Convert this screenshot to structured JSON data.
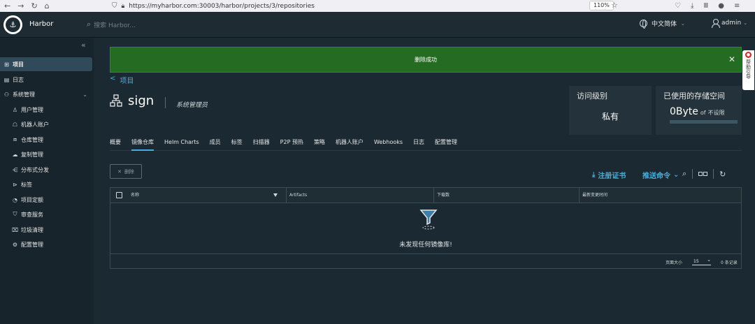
{
  "browser": {
    "nav_back": "←",
    "nav_forward": "→",
    "nav_reload": "↻",
    "nav_home": "⌂",
    "url": "https://myharbor.com:30003/harbor/projects/3/repositories",
    "zoom": "110%",
    "star": "☆"
  },
  "header": {
    "brand": "Harbor",
    "search_placeholder": "搜索 Harbor...",
    "language": "中文简体",
    "user": "admin"
  },
  "sidebar": {
    "items": [
      {
        "label": "项目",
        "icon": "projects-icon",
        "glyph": "⊞"
      },
      {
        "label": "日志",
        "icon": "logs-icon",
        "glyph": "▤"
      },
      {
        "label": "系统管理",
        "icon": "admin-icon",
        "glyph": "⚇"
      },
      {
        "label": "用户管理",
        "icon": "users-icon",
        "glyph": "♙"
      },
      {
        "label": "机器人账户",
        "icon": "robot-icon",
        "glyph": "☖"
      },
      {
        "label": "仓库管理",
        "icon": "registry-icon",
        "glyph": "⧈"
      },
      {
        "label": "复制管理",
        "icon": "replication-icon",
        "glyph": "☁"
      },
      {
        "label": "分布式分发",
        "icon": "distribution-icon",
        "glyph": "⋲"
      },
      {
        "label": "标签",
        "icon": "tag-icon",
        "glyph": "⊳"
      },
      {
        "label": "项目定额",
        "icon": "quota-icon",
        "glyph": "◔"
      },
      {
        "label": "审查服务",
        "icon": "shield-icon",
        "glyph": "⛉"
      },
      {
        "label": "垃圾清理",
        "icon": "trash-icon",
        "glyph": "⌧"
      },
      {
        "label": "配置管理",
        "icon": "settings-icon",
        "glyph": "⚙"
      }
    ]
  },
  "toast": {
    "message": "删除成功"
  },
  "side_tab": {
    "text": "帮助引导"
  },
  "project": {
    "back_label": "项目",
    "name": "sign",
    "role": "系统管理员"
  },
  "cards": {
    "access_title": "访问级别",
    "access_value": "私有",
    "storage_title": "已使用的存储空间",
    "storage_value": "0Byte",
    "storage_of": "of",
    "storage_limit": "不设限",
    "storage_used_fraction": 0
  },
  "tabs": [
    "概要",
    "镜像仓库",
    "Helm Charts",
    "成员",
    "标签",
    "扫描器",
    "P2P 预热",
    "策略",
    "机器人账户",
    "Webhooks",
    "日志",
    "配置管理"
  ],
  "active_tab": 1,
  "toolbar": {
    "delete_label": "删除",
    "registry_cert": "注册证书",
    "push_command": "推送命令"
  },
  "table": {
    "columns": [
      "名称",
      "Artifacts",
      "下载数",
      "最新变更时间"
    ],
    "empty_text": "未发现任何镜像库!",
    "page_size_label": "页面大小",
    "page_size": "15",
    "record_count": "0 条记录"
  },
  "colors": {
    "accent": "#49aeda",
    "toast_bg": "#266b22",
    "bg": "#1b2a32"
  }
}
